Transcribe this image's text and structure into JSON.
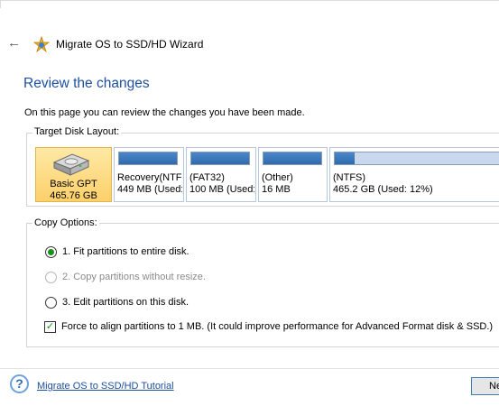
{
  "wizard": {
    "title": "Migrate OS to SSD/HD Wizard",
    "heading": "Review the changes",
    "description": "On this page you can review the changes you have been made."
  },
  "layout_group": {
    "legend": "Target Disk Layout:",
    "disk": {
      "type": "Basic GPT",
      "size": "465.76 GB"
    },
    "partitions": [
      {
        "name": "Recovery(NTF",
        "size": "449 MB (Used:",
        "used_fraction": 1.0
      },
      {
        "name": "(FAT32)",
        "size": "100 MB (Used:",
        "used_fraction": 1.0
      },
      {
        "name": "(Other)",
        "size": "16 MB",
        "used_fraction": 1.0
      },
      {
        "name": "(NTFS)",
        "size": "465.2 GB (Used: 12%)",
        "used_fraction": 0.12
      }
    ]
  },
  "copy_options": {
    "legend": "Copy Options:",
    "options": [
      {
        "label": "1. Fit partitions to entire disk.",
        "checked": true,
        "disabled": false
      },
      {
        "label": "2. Copy partitions without resize.",
        "checked": false,
        "disabled": true
      },
      {
        "label": "3. Edit partitions on this disk.",
        "checked": false,
        "disabled": false
      }
    ],
    "align": {
      "label": "Force to align partitions to 1 MB.  (It could improve performance for Advanced Format disk & SSD.)",
      "checked": true
    }
  },
  "footer": {
    "tutorial_link": "Migrate OS to SSD/HD Tutorial",
    "next_label": "Next"
  },
  "colors": {
    "heading": "#1d4fa0",
    "disk_tile": "#fcd06b",
    "partition_fill": "#2f6aad",
    "radio_checked": "#1a8f1a"
  }
}
